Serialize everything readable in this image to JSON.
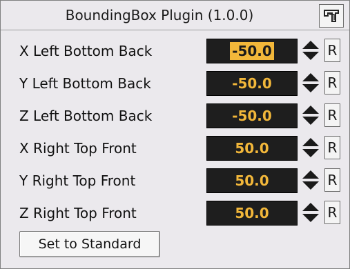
{
  "window": {
    "title": "BoundingBox Plugin (1.0.0)",
    "title_icon": "plugin-icon"
  },
  "fields": [
    {
      "label": "X Left Bottom Back",
      "value": "-50.0",
      "focused": true,
      "reset_label": "R"
    },
    {
      "label": "Y Left Bottom Back",
      "value": "-50.0",
      "focused": false,
      "reset_label": "R"
    },
    {
      "label": "Z Left Bottom Back",
      "value": "-50.0",
      "focused": false,
      "reset_label": "R"
    },
    {
      "label": "X Right Top Front",
      "value": "50.0",
      "focused": false,
      "reset_label": "R"
    },
    {
      "label": "Y Right Top Front",
      "value": "50.0",
      "focused": false,
      "reset_label": "R"
    },
    {
      "label": "Z Right Top Front",
      "value": "50.0",
      "focused": false,
      "reset_label": "R"
    }
  ],
  "actions": {
    "set_standard_label": "Set to Standard"
  },
  "colors": {
    "field_background": "#1e1e1e",
    "value_text": "#f2b73a",
    "panel_background": "#ebe9ed"
  }
}
